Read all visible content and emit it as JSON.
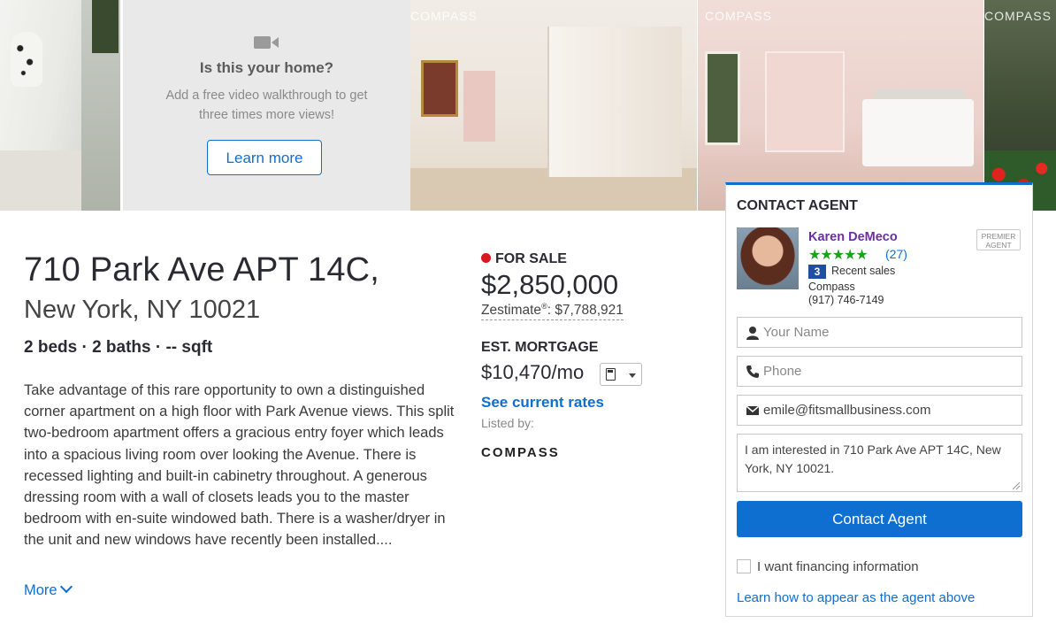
{
  "photos": {
    "watermark": "COMPASS",
    "promo": {
      "question": "Is this your home?",
      "description": "Add a free video walkthrough to get three times more views!",
      "button": "Learn more"
    }
  },
  "listing": {
    "address_line1": "710 Park Ave APT 14C,",
    "address_line2": "New York, NY 10021",
    "facts": "2 beds · 2 baths · -- sqft",
    "description": "Take advantage of this rare opportunity to own a distinguished corner apartment on a high floor with Park Avenue views. This split two-bedroom apartment offers a gracious entry foyer which leads into a spacious living room over looking the Avenue. There is recessed lighting and built-in cabinetry throughout. A generous dressing room with a wall of closets leads you to the master bedroom with en-suite windowed bath. There is a washer/dryer in the unit and new windows have recently been installed....",
    "more_label": "More"
  },
  "pricing": {
    "status": "FOR SALE",
    "status_color": "#d9191d",
    "price": "$2,850,000",
    "zestimate_label": "Zestimate",
    "zestimate_mark": "®",
    "zestimate_value": ": $7,788,921",
    "mortgage_heading": "EST. MORTGAGE",
    "mortgage_value": "$10,470/mo",
    "calculator_icon": "calculator-icon",
    "rates_link": "See current rates",
    "listed_by": "Listed by:",
    "broker_logo_text": "COMPASS"
  },
  "contact": {
    "heading": "CONTACT AGENT",
    "agent_name": "Karen DeMeco",
    "stars": "★★★★★",
    "review_count": "(27)",
    "recent_sales_count": "3",
    "recent_sales_label": "Recent sales",
    "firm": "Compass",
    "phone": "(917) 746-7149",
    "badge_line1": "PREMIER",
    "badge_line2": "AGENT",
    "name_placeholder": "Your Name",
    "phone_placeholder": "Phone",
    "email_value": "emile@fitsmallbusiness.com",
    "message_value": "I am interested in 710 Park Ave APT 14C, New York, NY 10021.",
    "submit_label": "Contact Agent",
    "financing_label": "I want financing information",
    "learn_link": "Learn how to appear as the agent above"
  },
  "colors": {
    "accent": "#0f6fd1",
    "agent_name": "#6b2fa3",
    "stars": "#1aa31a"
  }
}
